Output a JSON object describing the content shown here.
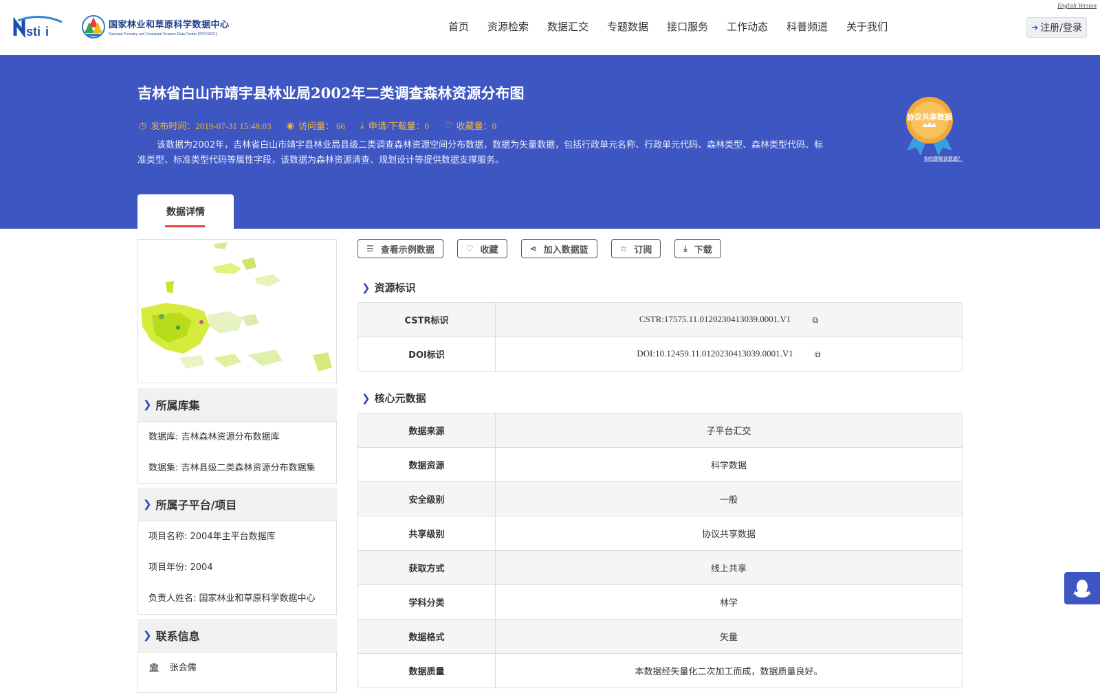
{
  "header": {
    "english_link": "English Version",
    "center_name_cn": "国家林业和草原科学数据中心",
    "center_name_en": "National Forestry and Grassland Science Data Center (NFGSDC)",
    "nav": [
      "首页",
      "资源检索",
      "数据汇交",
      "专题数据",
      "接口服务",
      "工作动态",
      "科普频道",
      "关于我们"
    ],
    "login_label": "注册/登录"
  },
  "banner": {
    "title": "吉林省白山市靖宇县林业局2002年二类调查森林资源分布图",
    "publish_time": "发布时间：2019-07-31 15:48:03",
    "visits": "访问量： 66",
    "downloads": "申请/下载量：0",
    "favorites": "收藏量：0",
    "description": "该数据为2002年，吉林省白山市靖宇县林业局县级二类调查森林资源空间分布数据，数据为矢量数据，包括行政单元名称、行政单元代码、森林类型、森林类型代码、标准类型、标准类型代码等属性字段，该数据为森林资源清查、规划设计等提供数据支撑服务。",
    "badge_label": "协议共享数据",
    "badge_link": "如何获取该数据？",
    "tab": "数据详情"
  },
  "sidebar": {
    "library_title": "所属库集",
    "library_items": [
      "数据库: 吉林森林资源分布数据库",
      "数据集: 吉林县级二类森林资源分布数据集"
    ],
    "project_title": "所属子平台/项目",
    "project_items": [
      "项目名称: 2004年主平台数据库",
      "项目年份: 2004",
      "负责人姓名: 国家林业和草原科学数据中心"
    ],
    "contact_title": "联系信息",
    "contact_name": "张会儒"
  },
  "actions": [
    "查看示例数据",
    "收藏",
    "加入数据篮",
    "订阅",
    "下载"
  ],
  "resource_id": {
    "title": "资源标识",
    "rows": [
      {
        "key": "CSTR标识",
        "value": "CSTR:17575.11.0120230413039.0001.V1"
      },
      {
        "key": "DOI标识",
        "value": "DOI:10.12459.11.0120230413039.0001.V1"
      }
    ]
  },
  "core_meta": {
    "title": "核心元数据",
    "rows": [
      {
        "key": "数据来源",
        "value": "子平台汇交"
      },
      {
        "key": "数据资源",
        "value": "科学数据"
      },
      {
        "key": "安全级别",
        "value": "一般"
      },
      {
        "key": "共享级别",
        "value": "协议共享数据"
      },
      {
        "key": "获取方式",
        "value": "线上共享"
      },
      {
        "key": "学科分类",
        "value": "林学"
      },
      {
        "key": "数据格式",
        "value": "矢量"
      },
      {
        "key": "数据质量",
        "value": "本数据经矢量化二次加工而成，数据质量良好。"
      }
    ]
  }
}
